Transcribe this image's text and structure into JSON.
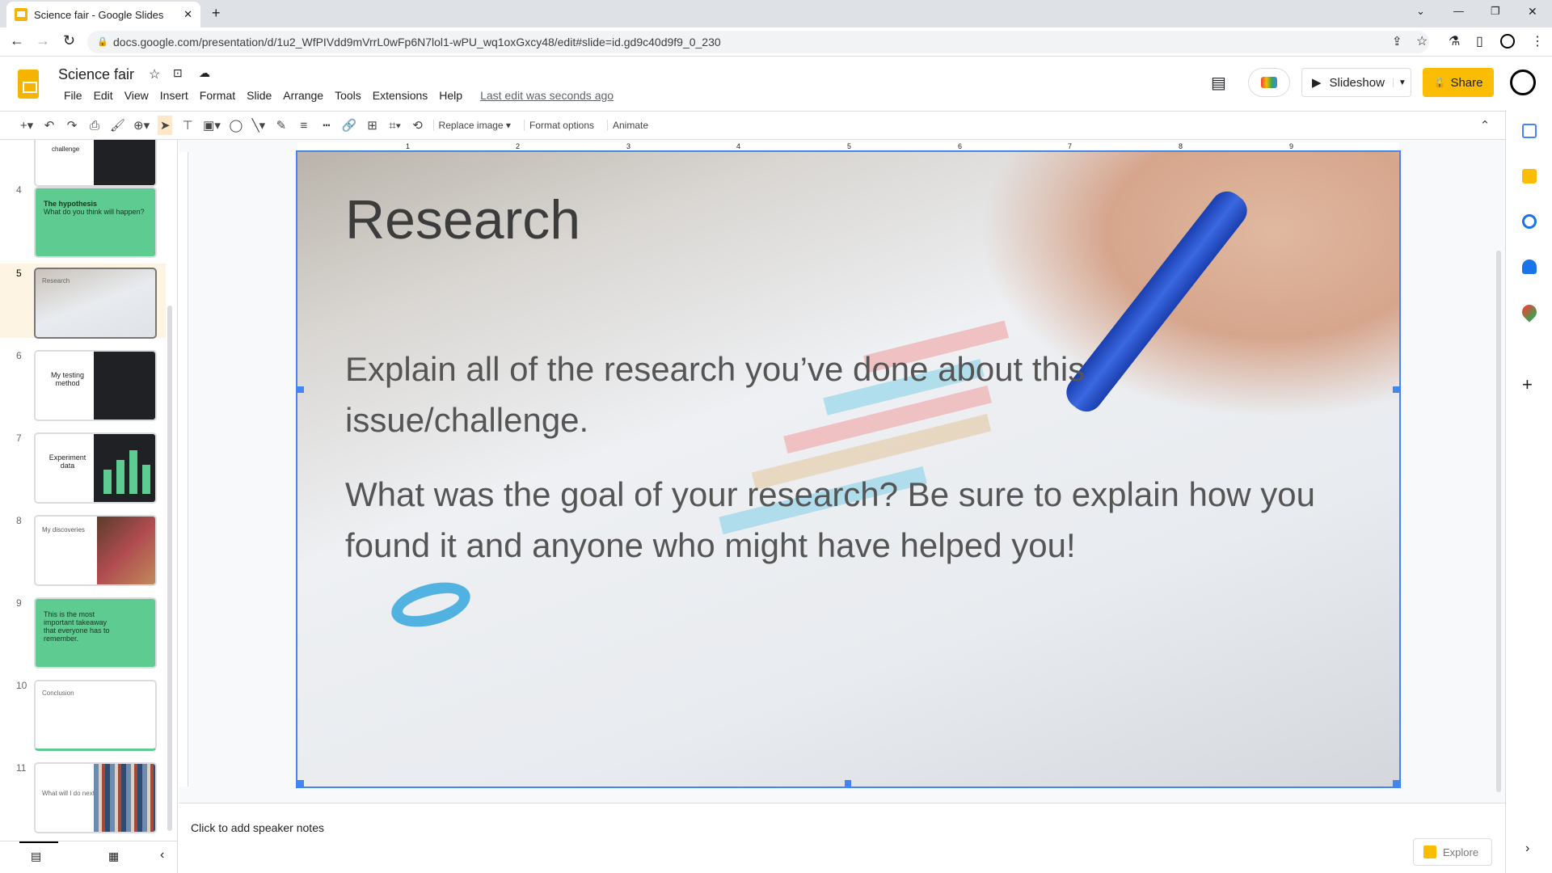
{
  "browser": {
    "tab_title": "Science fair - Google Slides",
    "url": "docs.google.com/presentation/d/1u2_WfPIVdd9mVrrL0wFp6N7lol1-wPU_wq1oxGxcy48/edit#slide=id.gd9c40d9f9_0_230"
  },
  "app": {
    "title": "Science fair",
    "menus": [
      "File",
      "Edit",
      "View",
      "Insert",
      "Format",
      "Slide",
      "Arrange",
      "Tools",
      "Extensions",
      "Help"
    ],
    "last_edit": "Last edit was seconds ago",
    "slideshow": "Slideshow",
    "share": "Share",
    "accent": "#fbbc04"
  },
  "toolbar": {
    "replace_image": "Replace image",
    "format_options": "Format options",
    "animate": "Animate"
  },
  "filmstrip": [
    {
      "num": "",
      "title": "challenge"
    },
    {
      "num": "4",
      "title": "The hypothesis",
      "body": "What do you think will happen?"
    },
    {
      "num": "5",
      "title": "Research"
    },
    {
      "num": "6",
      "title": "My testing method"
    },
    {
      "num": "7",
      "title": "Experiment data"
    },
    {
      "num": "8",
      "title": "My discoveries"
    },
    {
      "num": "9",
      "title": "This is the most important takeaway that everyone has to remember."
    },
    {
      "num": "10",
      "title": "Conclusion"
    },
    {
      "num": "11",
      "title": "What will I do next?"
    }
  ],
  "ruler": [
    "1",
    "2",
    "3",
    "4",
    "5",
    "6",
    "7",
    "8",
    "9"
  ],
  "slide": {
    "title": "Research",
    "body1": "Explain all of the research you’ve done about this issue/challenge.",
    "body2": "What was the goal of your research? Be sure to explain how you found it and anyone who might have helped you!"
  },
  "notes": {
    "placeholder": "Click to add speaker notes"
  },
  "explore": "Explore"
}
